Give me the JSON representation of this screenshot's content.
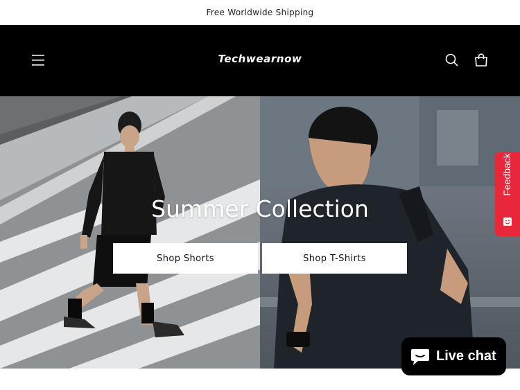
{
  "announcement": {
    "text": "Free Worldwide Shipping"
  },
  "header": {
    "logo_text": "Techwearnow",
    "menu_icon": "hamburger-menu-icon",
    "search_icon": "search-icon",
    "cart_icon": "cart-icon"
  },
  "hero": {
    "title": "Summer Collection",
    "buttons": [
      {
        "label": "Shop Shorts"
      },
      {
        "label": "Shop T-Shirts"
      }
    ]
  },
  "feedback": {
    "label": "Feedback",
    "color": "#e8283a"
  },
  "live_chat": {
    "label": "Live chat",
    "icon": "chat-bubble-icon"
  },
  "colors": {
    "header_bg": "#000000",
    "accent": "#e8283a",
    "button_bg": "#ffffff"
  }
}
